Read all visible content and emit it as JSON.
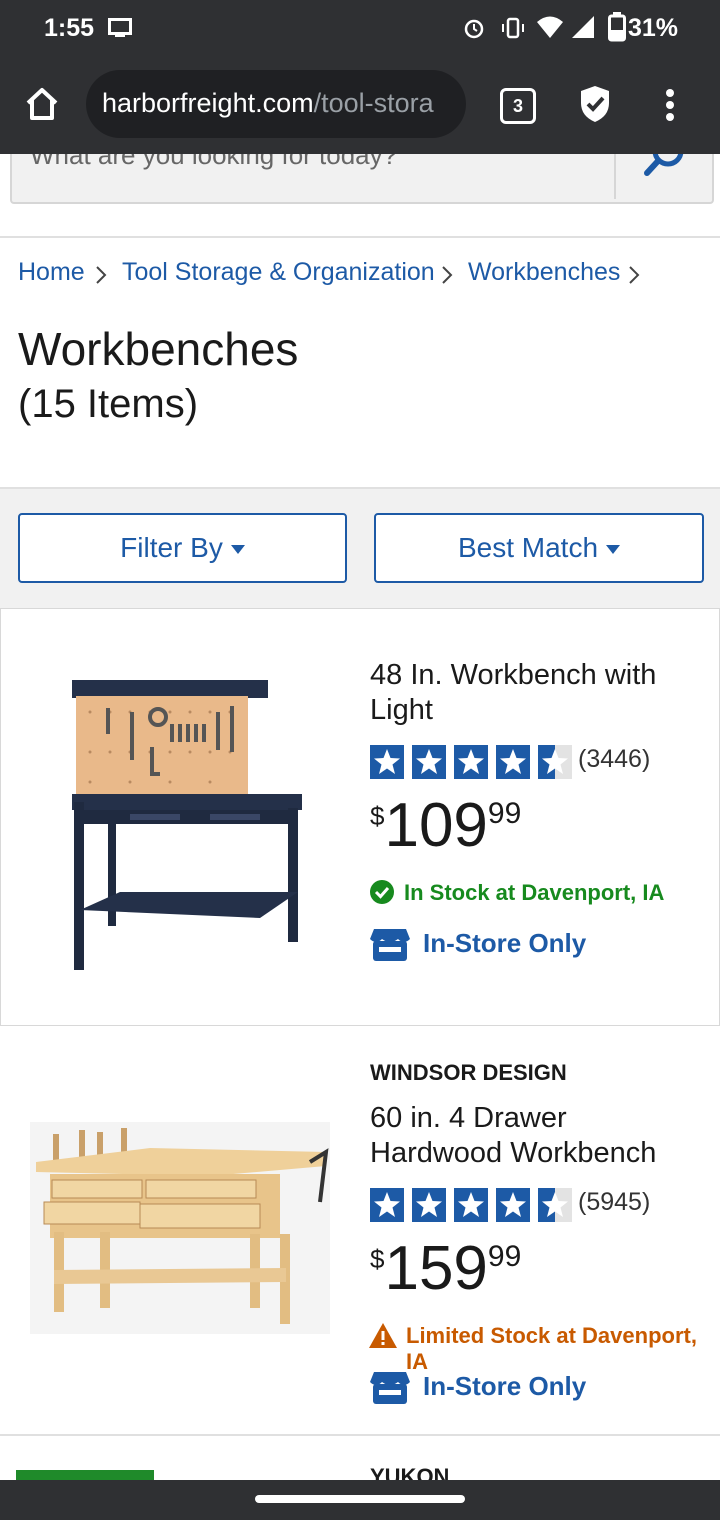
{
  "status_bar": {
    "time": "1:55",
    "battery": "31%"
  },
  "browser": {
    "url_domain": "harborfreight.com",
    "url_path": "/tool-stora",
    "tab_count": "3"
  },
  "search": {
    "placeholder": "What are you looking for today?"
  },
  "breadcrumb": {
    "home": "Home",
    "category": "Tool Storage & Organization",
    "current": "Workbenches",
    "sep": ">"
  },
  "page": {
    "title": "Workbenches",
    "item_count": "(15 Items)"
  },
  "controls": {
    "filter_label": "Filter By",
    "sort_label": "Best Match"
  },
  "products": [
    {
      "brand": "",
      "title": "48 In. Workbench with Light",
      "rating": 4.5,
      "review_count": "(3446)",
      "price_currency": "$",
      "price_dollars": "109",
      "price_cents": "99",
      "stock_text": "In Stock at Davenport, IA",
      "stock_color": "#178a1e",
      "fulfillment": "In-Store Only"
    },
    {
      "brand": "WINDSOR DESIGN",
      "title": "60 in. 4 Drawer Hardwood Workbench",
      "rating": 4.5,
      "review_count": "(5945)",
      "price_currency": "$",
      "price_dollars": "159",
      "price_cents": "99",
      "stock_text": "Limited Stock at Davenport, IA",
      "stock_color": "#c85a00",
      "fulfillment": "In-Store Only"
    }
  ],
  "next_product_brand_partial": "YUKON",
  "colors": {
    "link_blue": "#1d5aa6",
    "status_bar": "#2f3033",
    "filter_bg": "#f1f1f1"
  }
}
